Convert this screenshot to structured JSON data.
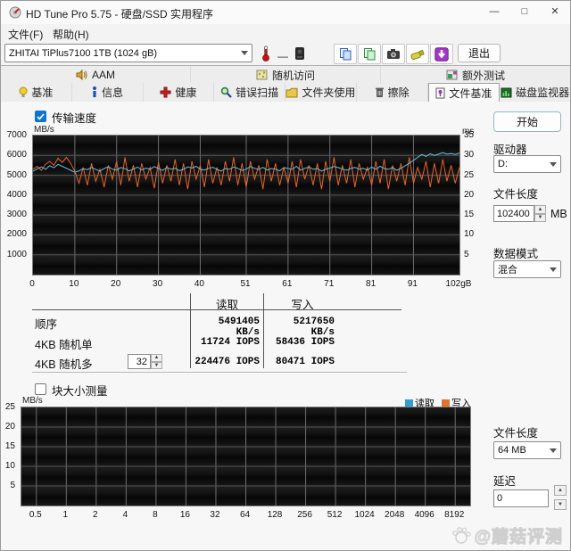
{
  "colors": {
    "read_line": "#62c2e2",
    "write_line": "#e8632c",
    "legend_read": "#2e9fd0",
    "legend_write": "#e0742e",
    "accent_blue": "#0b76d1",
    "chart_bg": "#0a0a0a",
    "grid_v": "#6e6e6e",
    "grid_h": "#565656"
  },
  "window": {
    "title": "HD Tune Pro 5.75 - 硬盘/SSD 实用程序",
    "minimize": "—",
    "maximize": "□",
    "close": "✕"
  },
  "menu": {
    "file": "文件(F)",
    "help": "帮助(H)"
  },
  "toolbar": {
    "drive_select": "ZHITAI TiPlus7100 1TB (1024 gB)",
    "temp_value": "—",
    "exit": "退出"
  },
  "tabs_row1": [
    {
      "label": "AAM"
    },
    {
      "label": "随机访问"
    },
    {
      "label": "额外测试"
    }
  ],
  "tabs_row2": [
    {
      "label": "基准"
    },
    {
      "label": "信息"
    },
    {
      "label": "健康"
    },
    {
      "label": "错误扫描"
    },
    {
      "label": "文件夹使用"
    },
    {
      "label": "擦除"
    },
    {
      "label": "文件基准"
    },
    {
      "label": "磁盘监视器"
    }
  ],
  "file_benchmark": {
    "transfer_checkbox": "传输速度",
    "block_checkbox": "块大小测量",
    "results": {
      "col_read": "读取",
      "col_write": "写入",
      "rows": [
        {
          "label": "顺序",
          "read": "5491405 KB/s",
          "write": "5217650 KB/s"
        },
        {
          "label": "4KB 随机单",
          "read": "11724 IOPS",
          "write": "58436 IOPS"
        },
        {
          "label": "4KB 随机多",
          "queue_depth": "32",
          "read": "224476 IOPS",
          "write": "80471 IOPS"
        }
      ]
    }
  },
  "panel": {
    "start": "开始",
    "drive_label": "驱动器",
    "drive_value": "D:",
    "filelen_label": "文件长度",
    "filelen_value": "102400",
    "filelen_unit": "MB",
    "datamode_label": "数据模式",
    "datamode_value": "混合",
    "filelen2_label": "文件长度",
    "filelen2_value": "64 MB",
    "delay_label": "延迟",
    "delay_value": "0"
  },
  "watermark": "@蘑菇评测",
  "chart_data": [
    {
      "type": "line",
      "title": "传输速度",
      "ylabel_left": "MB/s",
      "ylabel_right": "ms",
      "x_ticks": [
        "0",
        "10",
        "20",
        "30",
        "40",
        "51",
        "61",
        "71",
        "81",
        "91",
        "102gB"
      ],
      "x_tick_values": [
        0,
        10,
        20,
        30,
        40,
        51,
        61,
        71,
        81,
        91,
        102
      ],
      "x_range": [
        0,
        102
      ],
      "y_left_ticks": [
        7000,
        6000,
        5000,
        4000,
        3000,
        2000,
        1000
      ],
      "y_left_range": [
        0,
        7000
      ],
      "y_right_ticks": [
        35,
        30,
        25,
        20,
        15,
        10,
        5
      ],
      "y_right_range": [
        0,
        35
      ],
      "grid": true,
      "legend_position": "none",
      "series": [
        {
          "name": "读取",
          "color": "#62c2e2",
          "values": [
            5200,
            5320,
            5420,
            5300,
            5480,
            5380,
            5550,
            5450,
            5350,
            5250,
            5150,
            5220,
            5330,
            5280,
            5400,
            5300,
            5210,
            5340,
            5430,
            5310,
            5260,
            5390,
            5330,
            5220,
            5310,
            5410,
            5270,
            5360,
            5300,
            5440,
            5340,
            5240,
            5390,
            5310,
            5350,
            5230,
            5300,
            5420,
            5360,
            5450,
            5310,
            5260,
            5350,
            5400,
            5300,
            5210,
            5340,
            5300,
            5410,
            5350,
            5240,
            5310,
            5440,
            5350,
            5290,
            5400,
            5260,
            5340,
            5310,
            5220,
            5390,
            5340,
            5300,
            5450,
            5260,
            5350,
            5410,
            5300,
            5340,
            5210,
            5300,
            5360,
            5440,
            5390,
            5310,
            5250,
            5340,
            5400,
            5300,
            5350,
            5260,
            5410,
            5300,
            5450,
            5340,
            5300,
            5390,
            5250,
            5350,
            5480,
            5600,
            5750,
            5900,
            6050,
            5950,
            6080,
            6000,
            6060,
            6140,
            6060,
            6100,
            6050,
            6120
          ]
        },
        {
          "name": "写入",
          "color": "#e8632c",
          "values": [
            5300,
            5450,
            5250,
            5550,
            5700,
            5500,
            5850,
            5650,
            5900,
            5600,
            5200,
            4600,
            5400,
            4500,
            5600,
            4700,
            5300,
            4400,
            5500,
            4800,
            5700,
            4500,
            5900,
            4700,
            5500,
            4400,
            5600,
            4800,
            5400,
            4350,
            5650,
            4600,
            5500,
            4700,
            5800,
            4500,
            5600,
            4300,
            5700,
            4800,
            5500,
            4400,
            5800,
            4600,
            5400,
            4500,
            5700,
            4700,
            5900,
            4500,
            5600,
            4400,
            5700,
            4800,
            5500,
            4300,
            5800,
            4700,
            5600,
            4500,
            5400,
            4600,
            5700,
            4400,
            5800,
            4800,
            5500,
            4500,
            5600,
            4300,
            5700,
            4700,
            5900,
            4500,
            5500,
            4600,
            5800,
            4400,
            5600,
            4800,
            5400,
            4500,
            5700,
            4600,
            5800,
            4300,
            5500,
            4700,
            5600,
            4500,
            5900,
            4600,
            5400,
            4800,
            5700,
            4400,
            5600,
            4600,
            5800,
            4700,
            5500,
            4600,
            5400
          ]
        }
      ]
    },
    {
      "type": "line",
      "title": "块大小测量",
      "ylabel": "MB/s",
      "categories": [
        "0.5",
        "1",
        "2",
        "4",
        "8",
        "16",
        "32",
        "64",
        "128",
        "256",
        "512",
        "1024",
        "2048",
        "4096",
        "8192"
      ],
      "y_ticks": [
        25,
        20,
        15,
        10,
        5
      ],
      "ylim": [
        0,
        25
      ],
      "grid": true,
      "legend": [
        "读取",
        "写入"
      ],
      "legend_position": "top-right",
      "series": []
    }
  ]
}
